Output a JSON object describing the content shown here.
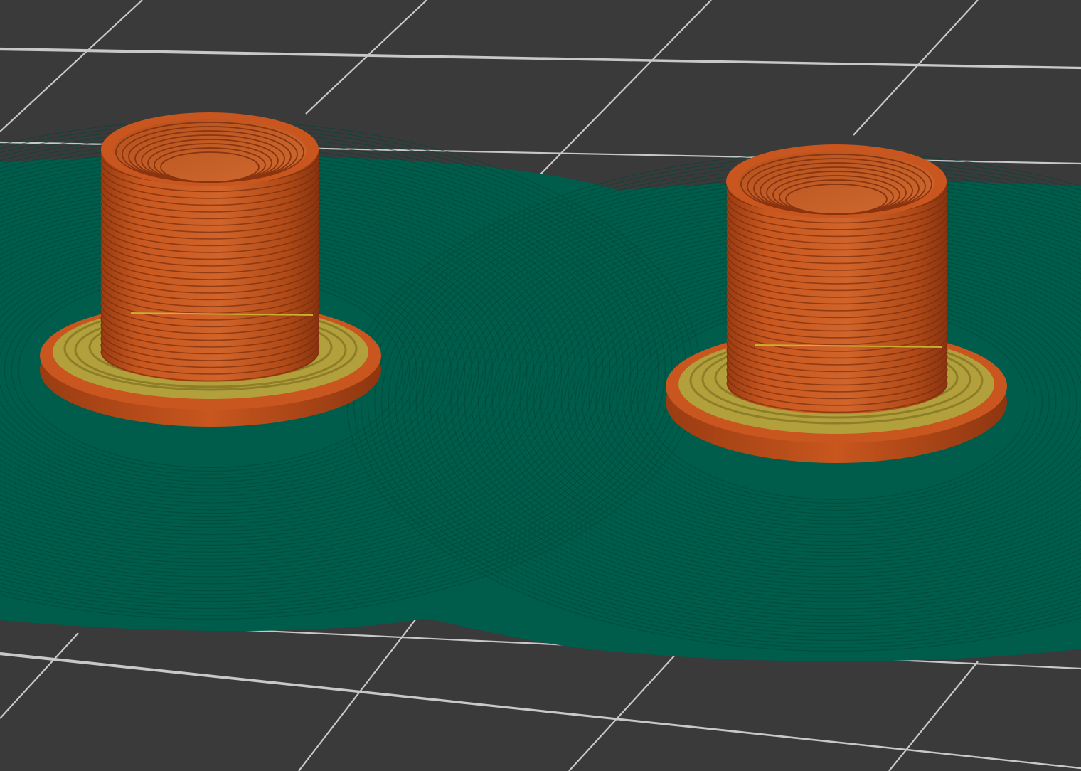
{
  "viewport": {
    "kind": "3d-print-preview",
    "background_color": "#3a3a3b",
    "grid_color": "#c8c8c8"
  },
  "feature_colors": {
    "skirt_brim": "#005c4b",
    "perimeter": "#c8561e",
    "solid_infill": "#b2a03c"
  },
  "objects": [
    {
      "name": "part-left",
      "features": [
        "perimeter",
        "solid_infill"
      ]
    },
    {
      "name": "part-right",
      "features": [
        "perimeter",
        "solid_infill"
      ]
    }
  ]
}
